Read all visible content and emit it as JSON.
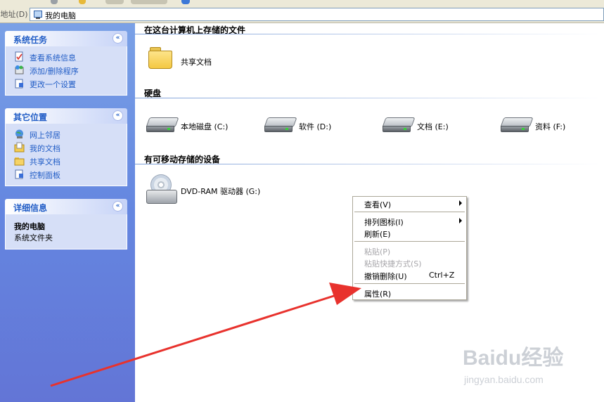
{
  "address_bar": {
    "label": "地址(D)",
    "value": "我的电脑"
  },
  "task_pane": {
    "system_tasks": {
      "title": "系统任务",
      "collapse_glyph": "«",
      "items": [
        {
          "label": "查看系统信息",
          "icon": "system-info-icon"
        },
        {
          "label": "添加/删除程序",
          "icon": "add-remove-programs-icon"
        },
        {
          "label": "更改一个设置",
          "icon": "change-setting-icon"
        }
      ]
    },
    "other_places": {
      "title": "其它位置",
      "collapse_glyph": "«",
      "items": [
        {
          "label": "网上邻居",
          "icon": "network-places-icon"
        },
        {
          "label": "我的文档",
          "icon": "my-documents-icon"
        },
        {
          "label": "共享文档",
          "icon": "shared-documents-icon"
        },
        {
          "label": "控制面板",
          "icon": "control-panel-icon"
        }
      ]
    },
    "details": {
      "title": "详细信息",
      "collapse_glyph": "«",
      "name": "我的电脑",
      "type": "系统文件夹"
    }
  },
  "content": {
    "sections": {
      "stored_files": {
        "title": "在这台计算机上存储的文件",
        "items": [
          {
            "label": "共享文档",
            "icon": "folder-icon"
          }
        ]
      },
      "hard_disks": {
        "title": "硬盘",
        "items": [
          {
            "label": "本地磁盘 (C:)",
            "icon": "hard-drive-icon"
          },
          {
            "label": "软件 (D:)",
            "icon": "hard-drive-icon"
          },
          {
            "label": "文档 (E:)",
            "icon": "hard-drive-icon"
          },
          {
            "label": "资料 (F:)",
            "icon": "hard-drive-icon"
          }
        ]
      },
      "removable": {
        "title": "有可移动存储的设备",
        "items": [
          {
            "label": "DVD-RAM 驱动器 (G:)",
            "icon": "dvd-drive-icon"
          }
        ]
      }
    }
  },
  "context_menu": {
    "items": [
      {
        "label": "查看(V)",
        "enabled": true,
        "submenu": true
      },
      {
        "label": "排列图标(I)",
        "enabled": true,
        "submenu": true
      },
      {
        "label": "刷新(E)",
        "enabled": true
      },
      {
        "label": "粘贴(P)",
        "enabled": false
      },
      {
        "label": "粘贴快捷方式(S)",
        "enabled": false
      },
      {
        "label": "撤销删除(U)",
        "enabled": true,
        "shortcut": "Ctrl+Z"
      },
      {
        "label": "属性(R)",
        "enabled": true
      }
    ]
  },
  "annotation": {
    "color": "#e8322d",
    "points_to": "属性(R)"
  },
  "watermark": {
    "main": "Baidu经验",
    "sub": "jingyan.baidu.com"
  }
}
